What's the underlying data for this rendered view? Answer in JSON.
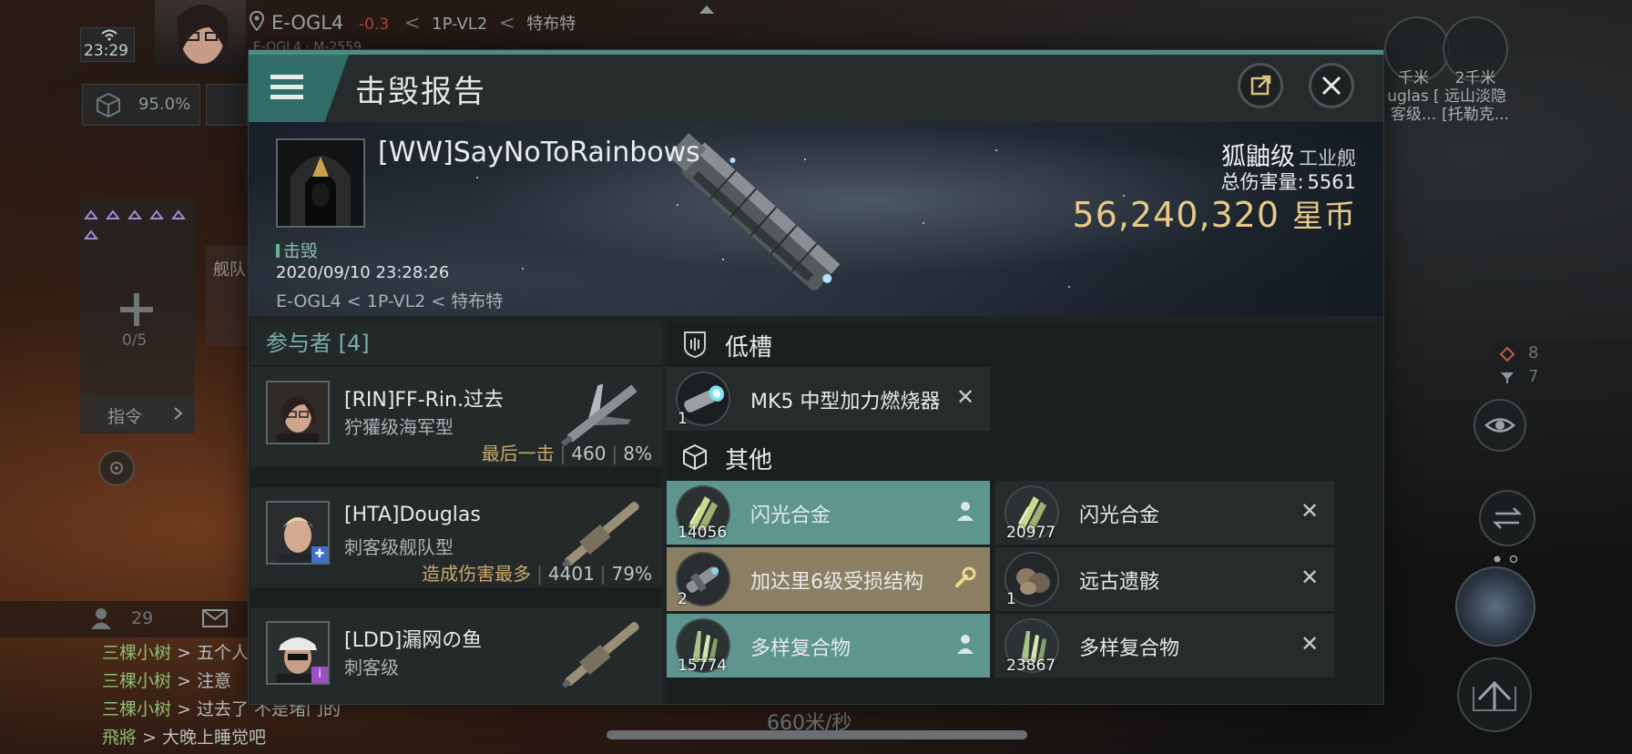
{
  "hud": {
    "location": {
      "system": "E-OGL4",
      "security": "-0.3",
      "region": "1P-VL2",
      "constellation": "特布特",
      "sub": "E-OGL4 · M-2559"
    },
    "clock": "23:29",
    "cargo_percent": "95.0%",
    "fleet": {
      "tab_label": "舰队",
      "slots": "0/5",
      "command_label": "指令"
    },
    "local_count": "29",
    "speed": "660米/秒",
    "right_list": [
      {
        "count": "8"
      },
      {
        "count": "7"
      }
    ],
    "overview": [
      {
        "distance": "千米",
        "name": "uglas [",
        "sub": "客级..."
      },
      {
        "distance": "2千米",
        "name": "远山淡隐",
        "sub": "[托勒克..."
      }
    ],
    "chat": [
      {
        "speaker": "三棵小树",
        "text": "> 五个人"
      },
      {
        "speaker": "三棵小树",
        "text": "> 注意"
      },
      {
        "speaker": "三棵小树",
        "text": "> 过去了 不是堵门的"
      },
      {
        "speaker": "飛將",
        "text": "> 大晚上睡觉吧"
      }
    ]
  },
  "modal": {
    "title": "击毁报告",
    "victim": {
      "name": "[WW]SayNoToRainbows",
      "status": "击毁",
      "time": "2020/09/10 23:28:26",
      "location": "E-OGL4 < 1P-VL2 < 特布特",
      "ship_class": "狐鼬级",
      "ship_type": "工业舰",
      "damage_label": "总伤害量:",
      "damage_value": "5561",
      "isk_value": "56,240,320",
      "isk_unit": "星币"
    },
    "participants": {
      "header": "参与者 [4]",
      "rows": [
        {
          "name": "[RIN]FF-Rin.过去",
          "ship": "狞獾级海军型",
          "tag": "最后一击",
          "damage": "460",
          "percent": "8%"
        },
        {
          "name": "[HTA]Douglas",
          "ship": "刺客级舰队型",
          "tag": "造成伤害最多",
          "damage": "4401",
          "percent": "79%"
        },
        {
          "name": "[LDD]漏网の鱼",
          "ship": "刺客级",
          "tag": "",
          "damage": "",
          "percent": ""
        }
      ]
    },
    "sections": {
      "low": "低槽",
      "other": "其他"
    },
    "low_items": [
      {
        "name": "MK5 中型加力燃烧器",
        "qty": "1",
        "state": "destroyed"
      }
    ],
    "other_items": [
      {
        "name": "闪光合金",
        "qty": "14056",
        "state": "dropped"
      },
      {
        "name": "闪光合金",
        "qty": "20977",
        "state": "destroyed"
      },
      {
        "name": "加达里6级受损结构",
        "qty": "2",
        "state": "fit"
      },
      {
        "name": "远古遗骸",
        "qty": "1",
        "state": "destroyed"
      },
      {
        "name": "多样复合物",
        "qty": "15774",
        "state": "dropped"
      },
      {
        "name": "多样复合物",
        "qty": "23867",
        "state": "destroyed"
      }
    ],
    "colors": {
      "accent": "#4f8b85",
      "dropped": "#5e968f",
      "fit": "#8a7f62",
      "isk": "#e8c987"
    }
  }
}
